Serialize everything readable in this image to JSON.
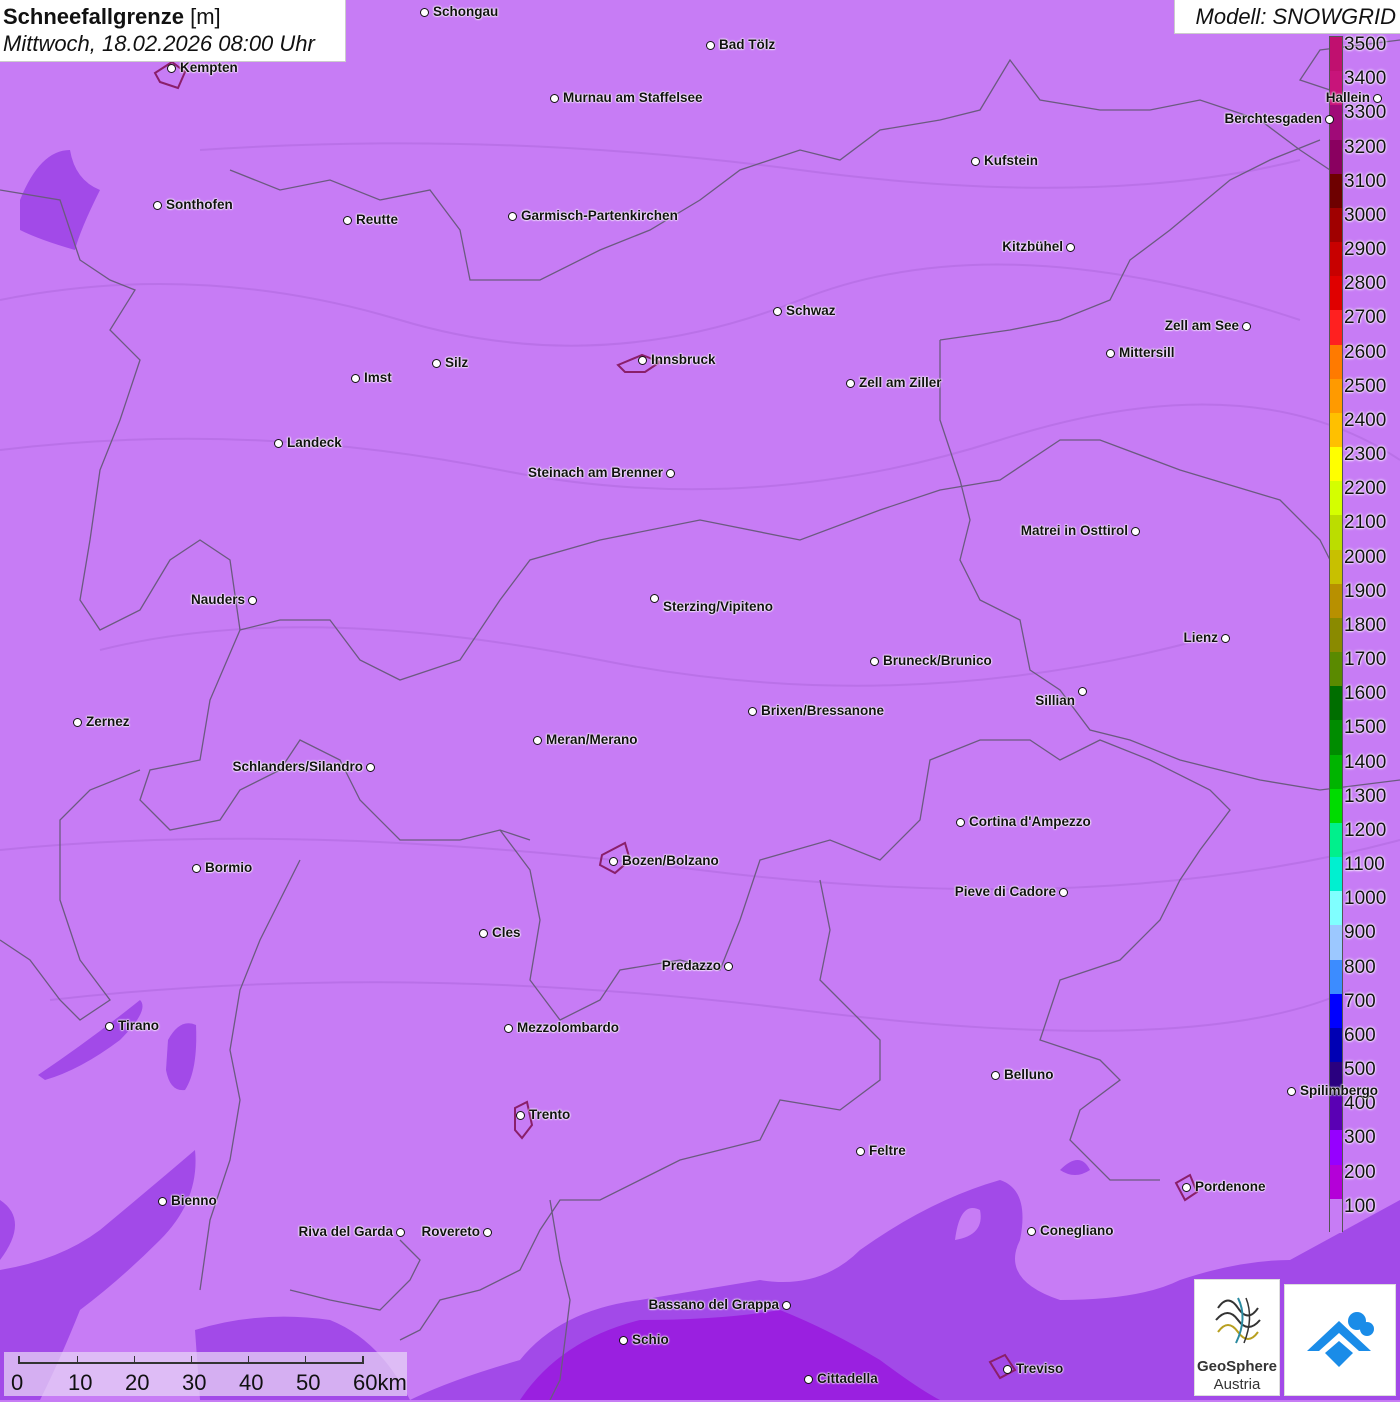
{
  "header": {
    "title_bold": "Schneefallgrenze",
    "title_unit": "[m]",
    "datetime": "Mittwoch, 18.02.2026 08:00 Uhr",
    "model": "Modell: SNOWGRID"
  },
  "legend": {
    "labels": [
      "3500",
      "3400",
      "3300",
      "3200",
      "3100",
      "3000",
      "2900",
      "2800",
      "2700",
      "2600",
      "2500",
      "2400",
      "2300",
      "2200",
      "2100",
      "2000",
      "1900",
      "1800",
      "1700",
      "1600",
      "1500",
      "1400",
      "1300",
      "1200",
      "1100",
      "1000",
      "900",
      "800",
      "700",
      "600",
      "500",
      "400",
      "300",
      "200",
      "100"
    ],
    "colors": [
      "#c0106f",
      "#c8147a",
      "#a00a78",
      "#8a0060",
      "#6e0000",
      "#a00000",
      "#c80000",
      "#e00000",
      "#ff2020",
      "#ff7a00",
      "#ff9a00",
      "#ffc000",
      "#ffff00",
      "#d4ff00",
      "#bbdd00",
      "#c8c000",
      "#b89000",
      "#8a8a00",
      "#5a8a00",
      "#006e00",
      "#008c00",
      "#00b400",
      "#00dc00",
      "#00f08c",
      "#00f0d0",
      "#80ffff",
      "#9cc8ff",
      "#3c8cff",
      "#0000ff",
      "#0000b4",
      "#2a0080",
      "#5a00b4",
      "#9600ff",
      "#b400d8",
      "#c77cf5"
    ]
  },
  "cities": [
    {
      "name": "Schongau"
    },
    {
      "name": "Bad Tölz"
    },
    {
      "name": "Kempten"
    },
    {
      "name": "Murnau am Staffelsee"
    },
    {
      "name": "Kufstein"
    },
    {
      "name": "Sonthofen"
    },
    {
      "name": "Reutte"
    },
    {
      "name": "Garmisch-Partenkirchen"
    },
    {
      "name": "Kitzbühel"
    },
    {
      "name": "Schwaz"
    },
    {
      "name": "Zell am See"
    },
    {
      "name": "Innsbruck"
    },
    {
      "name": "Mittersill"
    },
    {
      "name": "Imst"
    },
    {
      "name": "Silz"
    },
    {
      "name": "Zell am Ziller"
    },
    {
      "name": "Landeck"
    },
    {
      "name": "Steinach am Brenner"
    },
    {
      "name": "Matrei in Osttirol"
    },
    {
      "name": "Nauders"
    },
    {
      "name": "Sterzing/Vipiteno"
    },
    {
      "name": "Lienz"
    },
    {
      "name": "Bruneck/Brunico"
    },
    {
      "name": "Sillian"
    },
    {
      "name": "Zernez"
    },
    {
      "name": "Brixen/Bressanone"
    },
    {
      "name": "Meran/Merano"
    },
    {
      "name": "Schlanders/Silandro"
    },
    {
      "name": "Cortina d'Ampezzo"
    },
    {
      "name": "Bozen/Bolzano"
    },
    {
      "name": "Bormio"
    },
    {
      "name": "Pieve di Cadore"
    },
    {
      "name": "Cles"
    },
    {
      "name": "Predazzo"
    },
    {
      "name": "Tirano"
    },
    {
      "name": "Mezzolombardo"
    },
    {
      "name": "Belluno"
    },
    {
      "name": "Spilimbergo"
    },
    {
      "name": "Trento"
    },
    {
      "name": "Feltre"
    },
    {
      "name": "Pordenone"
    },
    {
      "name": "Bienno"
    },
    {
      "name": "Riva del Garda"
    },
    {
      "name": "Rovereto"
    },
    {
      "name": "Conegliano"
    },
    {
      "name": "Bassano del Grappa"
    },
    {
      "name": "Schio"
    },
    {
      "name": "Treviso"
    },
    {
      "name": "Cittadella"
    },
    {
      "name": "Berchtesgaden"
    },
    {
      "name": "Hallein"
    }
  ],
  "scale": {
    "ticks": [
      "0",
      "10",
      "20",
      "30",
      "40",
      "50",
      "60km"
    ]
  },
  "logos": {
    "geosphere_line1": "GeoSphere",
    "geosphere_line2": "Austria"
  },
  "colors": {
    "base_snowline": "#c77cf5",
    "low_snowline": "#a24ae8",
    "lowest_snowline": "#9a20e0",
    "border": "#6b5a80"
  }
}
